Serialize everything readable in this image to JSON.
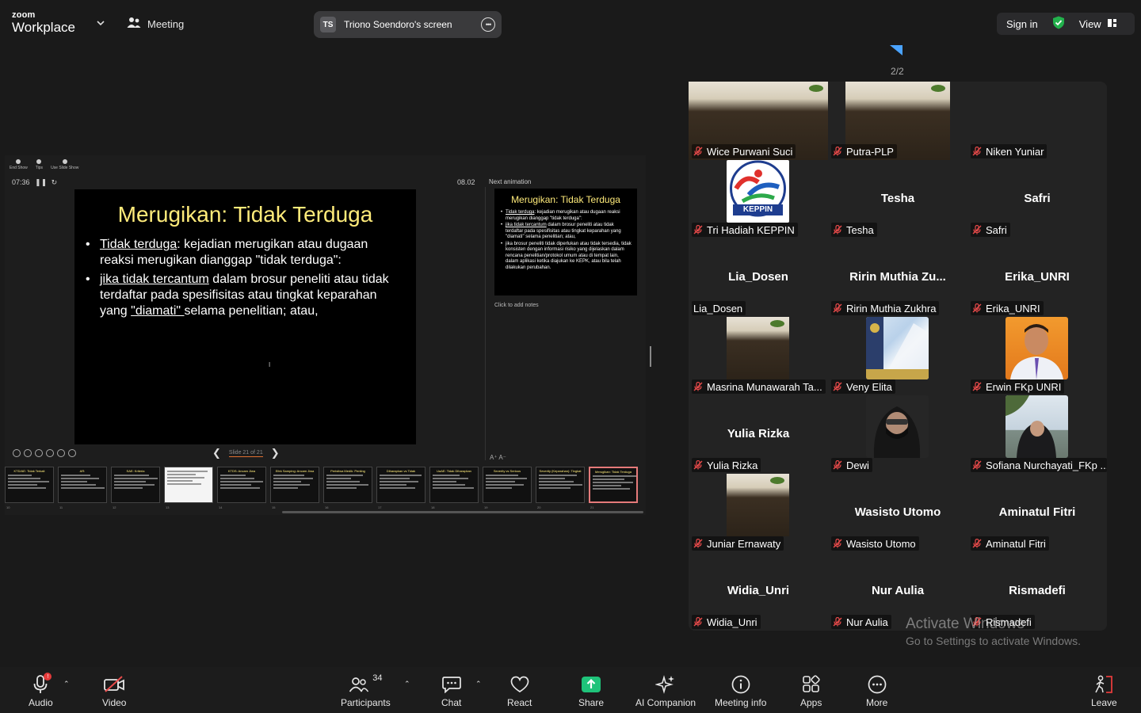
{
  "app": {
    "logo_line1": "zoom",
    "logo_line2": "Workplace",
    "meeting_label": "Meeting"
  },
  "share": {
    "presenter_initials": "TS",
    "presenter_label": "Triono Soendoro's screen"
  },
  "top_right": {
    "sign_in": "Sign in",
    "view": "View"
  },
  "presentation": {
    "toolbar": [
      "End Show",
      "Tips",
      "Use Slide Show"
    ],
    "elapsed": "07:36",
    "clock": "08.02",
    "next_animation": "Next animation",
    "notes_placeholder": "Click to add notes",
    "slide_counter": "Slide 21 of 21",
    "current_slide": {
      "title": "Merugikan: Tidak Terduga",
      "b1_u": "Tidak terduga",
      "b1_rest": ": kejadian merugikan atau dugaan reaksi merugikan dianggap \"tidak terduga\":",
      "b2_u": "jika tidak tercantum",
      "b2_rest1": " dalam brosur peneliti atau tidak terdaftar pada spesifisitas atau tingkat keparahan yang ",
      "b2_u2": "\"diamati\" ",
      "b2_rest2": "selama penelitian; atau,"
    },
    "next_slide": {
      "title": "Merugikan: Tidak Terduga",
      "b1_u": "Tidak terduga",
      "b1_rest": ": kejadian merugikan atau dugaan reaksi merugikan dianggap \"tidak terduga\":",
      "b2_u": "jika tidak tercantum",
      "b2_rest": " dalam brosur peneliti atau tidak terdaftar pada spesifisitas atau tingkat keparahan yang \"diamati\" selama penelitian; atau,",
      "b3": "jika brosur peneliti tidak diperlukan atau tidak tersedia, tidak konsisten dengan informasi risiko yang dijelaskan dalam rencana penelitian/protokol umum atau di tempat lain, dalam aplikasi ketika diajukan ke KEPK, atau bila telah dilakukan perubahan."
    },
    "thumbnails": [
      {
        "num": "10",
        "title": "KTD/AE: Tidak Terkait"
      },
      {
        "num": "11",
        "title": "AR:"
      },
      {
        "num": "12",
        "title": "SAE: Kriteria"
      },
      {
        "num": "13",
        "title": ""
      },
      {
        "num": "14",
        "title": "KTDS: Ancam Jiwa"
      },
      {
        "num": "15",
        "title": "Efek Samping: Ancam Jiwa"
      },
      {
        "num": "16",
        "title": "Peristiwa Medik: Penting"
      },
      {
        "num": "17",
        "title": "Diharapkan vs Tidak"
      },
      {
        "num": "18",
        "title": "UaAE: Tidak Diharapkan"
      },
      {
        "num": "19",
        "title": "Severity vs Serious"
      },
      {
        "num": "20",
        "title": "Severity (Keparahan): Tingkat"
      },
      {
        "num": "21",
        "title": "Merugikan: Tidak Terduga"
      }
    ]
  },
  "gallery": {
    "page": "2/2",
    "participants": [
      {
        "name": "Wice Purwani Suci",
        "center": "",
        "kind": "banner"
      },
      {
        "name": "Putra-PLP",
        "center": "",
        "kind": "banner-narrow"
      },
      {
        "name": "Niken Yuniar",
        "center": "",
        "kind": "none"
      },
      {
        "name": "Tri Hadiah KEPPIN",
        "center": "",
        "kind": "logo",
        "logo_text": "KEPPIN"
      },
      {
        "name": "Tesha",
        "center": "Tesha",
        "kind": "none"
      },
      {
        "name": "Safri",
        "center": "Safri",
        "kind": "none"
      },
      {
        "name": "Lia_Dosen",
        "center": "Lia_Dosen",
        "kind": "none",
        "unmuted": true
      },
      {
        "name": "Ririn Muthia Zukhra",
        "center": "Ririn  Muthia  Zu...",
        "kind": "none"
      },
      {
        "name": "Erika_UNRI",
        "center": "Erika_UNRI",
        "kind": "none"
      },
      {
        "name": "Masrina Munawarah Ta...",
        "center": "",
        "kind": "banner-small"
      },
      {
        "name": "Veny Elita",
        "center": "",
        "kind": "building"
      },
      {
        "name": "Erwin FKp UNRI",
        "center": "",
        "kind": "portrait"
      },
      {
        "name": "Yulia Rizka",
        "center": "Yulia Rizka",
        "kind": "none"
      },
      {
        "name": "Dewi",
        "center": "",
        "kind": "hijab-dark"
      },
      {
        "name": "Sofiana Nurchayati_FKp ...",
        "center": "",
        "kind": "beach"
      },
      {
        "name": "Juniar Ernawaty",
        "center": "",
        "kind": "banner-small"
      },
      {
        "name": "Wasisto Utomo",
        "center": "Wasisto Utomo",
        "kind": "none"
      },
      {
        "name": "Aminatul Fitri",
        "center": "Aminatul Fitri",
        "kind": "none"
      },
      {
        "name": "Widia_Unri",
        "center": "Widia_Unri",
        "kind": "none"
      },
      {
        "name": "Nur Aulia",
        "center": "Nur Aulia",
        "kind": "none"
      },
      {
        "name": "Rismadefi",
        "center": "Rismadefi",
        "kind": "none"
      }
    ]
  },
  "watermark": {
    "line1": "Activate Windows",
    "line2": "Go to Settings to activate Windows."
  },
  "toolbar": {
    "audio": "Audio",
    "audio_badge": "!",
    "video": "Video",
    "participants": "Participants",
    "participants_count": "34",
    "chat": "Chat",
    "react": "React",
    "share": "Share",
    "ai_companion": "AI Companion",
    "meeting_info": "Meeting info",
    "apps": "Apps",
    "more": "More",
    "leave": "Leave"
  },
  "colors": {
    "accent_blue": "#4aa3ff",
    "share_green": "#1fc37a",
    "shield_green": "#22b14c",
    "muted_red": "#e84a4a",
    "leave_red": "#e53b3b",
    "slide_title_yellow": "#ffeb7a"
  }
}
